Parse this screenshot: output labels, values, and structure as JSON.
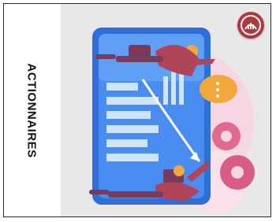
{
  "card": {
    "side_label": "ACTIONNAIRES"
  },
  "illustration": {
    "icon": "shareholders-presentation-illustration"
  },
  "logo": {
    "icon": "brand-logo-icon",
    "color": "#b5363a"
  },
  "colors": {
    "panel_bg": "#e8e8e8",
    "board_blue": "#3d7fe0",
    "accent_orange": "#f2a83b",
    "figure_red": "#b0455a",
    "halo_pink": "#f5c9d6"
  }
}
